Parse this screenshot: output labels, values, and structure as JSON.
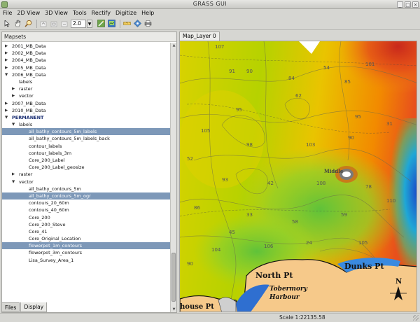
{
  "window": {
    "title": "GRASS GUI"
  },
  "menu": [
    "File",
    "2D View",
    "3D View",
    "Tools",
    "Rectify",
    "Digitize",
    "Help"
  ],
  "toolbar": {
    "zoom_value": "2.0"
  },
  "left_pane": {
    "header": "Mapsets",
    "tree": [
      {
        "label": "2001_MB_Data",
        "level": 0,
        "toggle": "closed"
      },
      {
        "label": "2002_MB_Data",
        "level": 0,
        "toggle": "closed"
      },
      {
        "label": "2004_MB_Data",
        "level": 0,
        "toggle": "closed"
      },
      {
        "label": "2005_MB_Data",
        "level": 0,
        "toggle": "closed"
      },
      {
        "label": "2006_MB_Data",
        "level": 0,
        "toggle": "open"
      },
      {
        "label": "labels",
        "level": 1,
        "toggle": ""
      },
      {
        "label": "raster",
        "level": 1,
        "toggle": "closed"
      },
      {
        "label": "vector",
        "level": 1,
        "toggle": "closed"
      },
      {
        "label": "2007_MB_Data",
        "level": 0,
        "toggle": "closed"
      },
      {
        "label": "2010_MB_Data",
        "level": 0,
        "toggle": "closed"
      },
      {
        "label": "PERMANENT",
        "level": 0,
        "toggle": "open",
        "bold": true
      },
      {
        "label": "labels",
        "level": 1,
        "toggle": "open"
      },
      {
        "label": "all_bathy_contours_5m_labels",
        "level": 2,
        "toggle": "",
        "selected": true
      },
      {
        "label": "all_bathy_contours_5m_labels_back",
        "level": 2,
        "toggle": ""
      },
      {
        "label": "contour_labels",
        "level": 2,
        "toggle": ""
      },
      {
        "label": "contour_labels_3m",
        "level": 2,
        "toggle": ""
      },
      {
        "label": "Core_200_Label",
        "level": 2,
        "toggle": ""
      },
      {
        "label": "Core_200_Label_geosize",
        "level": 2,
        "toggle": ""
      },
      {
        "label": "raster",
        "level": 1,
        "toggle": "closed"
      },
      {
        "label": "vector",
        "level": 1,
        "toggle": "open"
      },
      {
        "label": "all_bathy_contours_5m",
        "level": 2,
        "toggle": ""
      },
      {
        "label": "all_bathy_contours_5m_ogr",
        "level": 2,
        "toggle": "",
        "selected": true
      },
      {
        "label": "contours_20_60m",
        "level": 2,
        "toggle": ""
      },
      {
        "label": "contours_40_60m",
        "level": 2,
        "toggle": ""
      },
      {
        "label": "Core_200",
        "level": 2,
        "toggle": ""
      },
      {
        "label": "Core_200_Steve",
        "level": 2,
        "toggle": ""
      },
      {
        "label": "Core_41",
        "level": 2,
        "toggle": ""
      },
      {
        "label": "Core_Original_Location",
        "level": 2,
        "toggle": ""
      },
      {
        "label": "flowerpot_1m_contours",
        "level": 2,
        "toggle": "",
        "selected": true
      },
      {
        "label": "flowerpot_3m_contours",
        "level": 2,
        "toggle": ""
      },
      {
        "label": "Lisa_Survey_Area_1",
        "level": 2,
        "toggle": ""
      }
    ],
    "tabs": [
      "Files",
      "Display"
    ]
  },
  "map": {
    "tab_label": "Map_Layer 0",
    "labels": [
      "North Pt",
      "Dunks Pt",
      "Tobermory",
      "Harbour",
      "house Pt",
      "Middle"
    ],
    "north": "N",
    "contour_numbers": [
      "107",
      "91",
      "90",
      "84",
      "54",
      "101",
      "85",
      "95",
      "62",
      "95",
      "105",
      "98",
      "103",
      "90",
      "31",
      "52",
      "93",
      "42",
      "108",
      "78",
      "86",
      "33",
      "58",
      "59",
      "110",
      "45",
      "104",
      "106",
      "24",
      "105",
      "90"
    ]
  },
  "status": {
    "scale": "Scale 1:22135.58"
  }
}
